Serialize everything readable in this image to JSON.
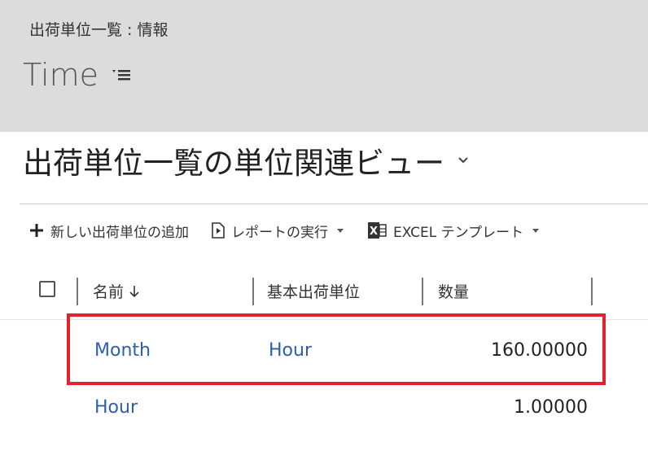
{
  "header": {
    "breadcrumb": "出荷単位一覧 : 情報",
    "record_name": "Time"
  },
  "view": {
    "title": "出荷単位一覧の単位関連ビュー"
  },
  "commands": {
    "add": "新しい出荷単位の追加",
    "run_report": "レポートの実行",
    "excel_template": "EXCEL テンプレート"
  },
  "grid": {
    "columns": [
      "名前",
      "基本出荷単位",
      "数量"
    ],
    "rows": [
      {
        "name": "Month",
        "base_unit": "Hour",
        "quantity": "160.00000"
      },
      {
        "name": "Hour",
        "base_unit": "",
        "quantity": "1.00000"
      }
    ]
  },
  "colors": {
    "header_bg": "#dcdcdc",
    "link": "#2e5fa8",
    "highlight": "#e3222e"
  },
  "icons": [
    "menu-icon",
    "chevron-down-icon",
    "plus-icon",
    "report-icon",
    "excel-icon",
    "sort-down-arrow-icon",
    "checkbox"
  ]
}
